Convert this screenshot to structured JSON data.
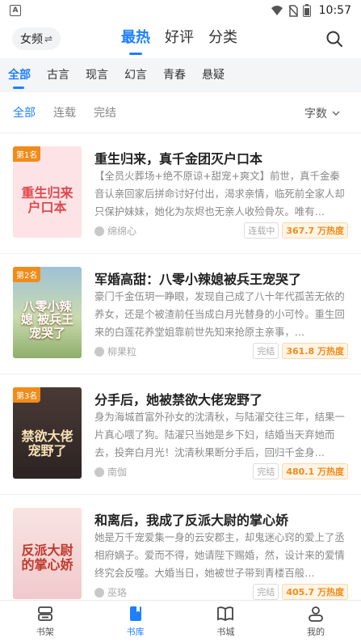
{
  "status_bar": {
    "time": "10:57",
    "app_icon": "A"
  },
  "header": {
    "gender_label": "女频",
    "gender_switch_glyph": "⇌",
    "tabs": [
      {
        "label": "最热",
        "active": true
      },
      {
        "label": "好评",
        "active": false
      },
      {
        "label": "分类",
        "active": false
      }
    ]
  },
  "genres": [
    {
      "label": "全部",
      "active": true
    },
    {
      "label": "古言",
      "active": false
    },
    {
      "label": "现言",
      "active": false
    },
    {
      "label": "幻言",
      "active": false
    },
    {
      "label": "青春",
      "active": false
    },
    {
      "label": "悬疑",
      "active": false
    }
  ],
  "filters": [
    {
      "label": "全部",
      "active": true
    },
    {
      "label": "连载",
      "active": false
    },
    {
      "label": "完结",
      "active": false
    }
  ],
  "sort": {
    "label": "字数"
  },
  "books": [
    {
      "rank": "第1名",
      "title": "重生归来，真千金团灭户口本",
      "desc": "【全员火葬场+绝不原谅+甜宠+爽文】前世，真千金秦音认亲回家后拼命讨好付出，渴求亲情，临死前全家人却只保护妹妹，她化为灰烬也无亲人收殓骨灰。唯有…",
      "author": "绵绵心",
      "status": "连载中",
      "heat": "367.7 万热度",
      "cover_text": "重生归来 户口本",
      "cover_bg": "#fde3e6",
      "cover_color": "#e0474c"
    },
    {
      "rank": "第2名",
      "title": "军婚高甜：八零小辣媳被兵王宠哭了",
      "desc": "豪门千金伍玥一睁眼，发现自己成了八十年代孤苦无依的养女，还是个被渣前任当成白月光替身的小可怜。重生回来的白莲花养堂姐靠前世先知来抢原主亲事，…",
      "author": "柳果粒",
      "status": "完结",
      "heat": "361.8 万热度",
      "cover_text": "八零小辣媳 被兵王宠哭了",
      "cover_bg": "#c7d9a8",
      "cover_color": "#ffffff"
    },
    {
      "rank": "第3名",
      "title": "分手后，她被禁欲大佬宠野了",
      "desc": "身为海城首富外孙女的沈清秋，与陆濯交往三年，结果一片真心喂了狗。陆濯只当她是乡下妇，结婚当天弃她而去，投奔白月光！沈清秋果断分手后，回归千金身…",
      "author": "南伽",
      "status": "完结",
      "heat": "480.1 万热度",
      "cover_text": "禁欲大佬 宠野了",
      "cover_bg": "#3b2f2f",
      "cover_color": "#f7e2b6"
    },
    {
      "rank": "",
      "title": "和离后，我成了反派大尉的掌心娇",
      "desc": "她是万千宠爱集一身的云安郡主，却鬼迷心窍的爱上了丞相府嫡子。爱而不得，她请陛下赐婚，然，设计来的爱情终究会反噬。大婚当日，她被世子带到青楼百般…",
      "author": "巫珞",
      "status": "完结",
      "heat": "405.7 万热度",
      "cover_text": "反派大尉 的掌心娇",
      "cover_bg": "#f4d6d8",
      "cover_color": "#c0392b"
    }
  ],
  "bottom_nav": [
    {
      "label": "书架",
      "icon": "bookshelf-icon",
      "active": false
    },
    {
      "label": "书库",
      "icon": "library-icon",
      "active": true
    },
    {
      "label": "书城",
      "icon": "bookstore-icon",
      "active": false
    },
    {
      "label": "我的",
      "icon": "profile-icon",
      "active": false
    }
  ],
  "colors": {
    "accent": "#1e80ff",
    "rank_badge": "#f08c1a",
    "heat": "#f08c1a"
  }
}
